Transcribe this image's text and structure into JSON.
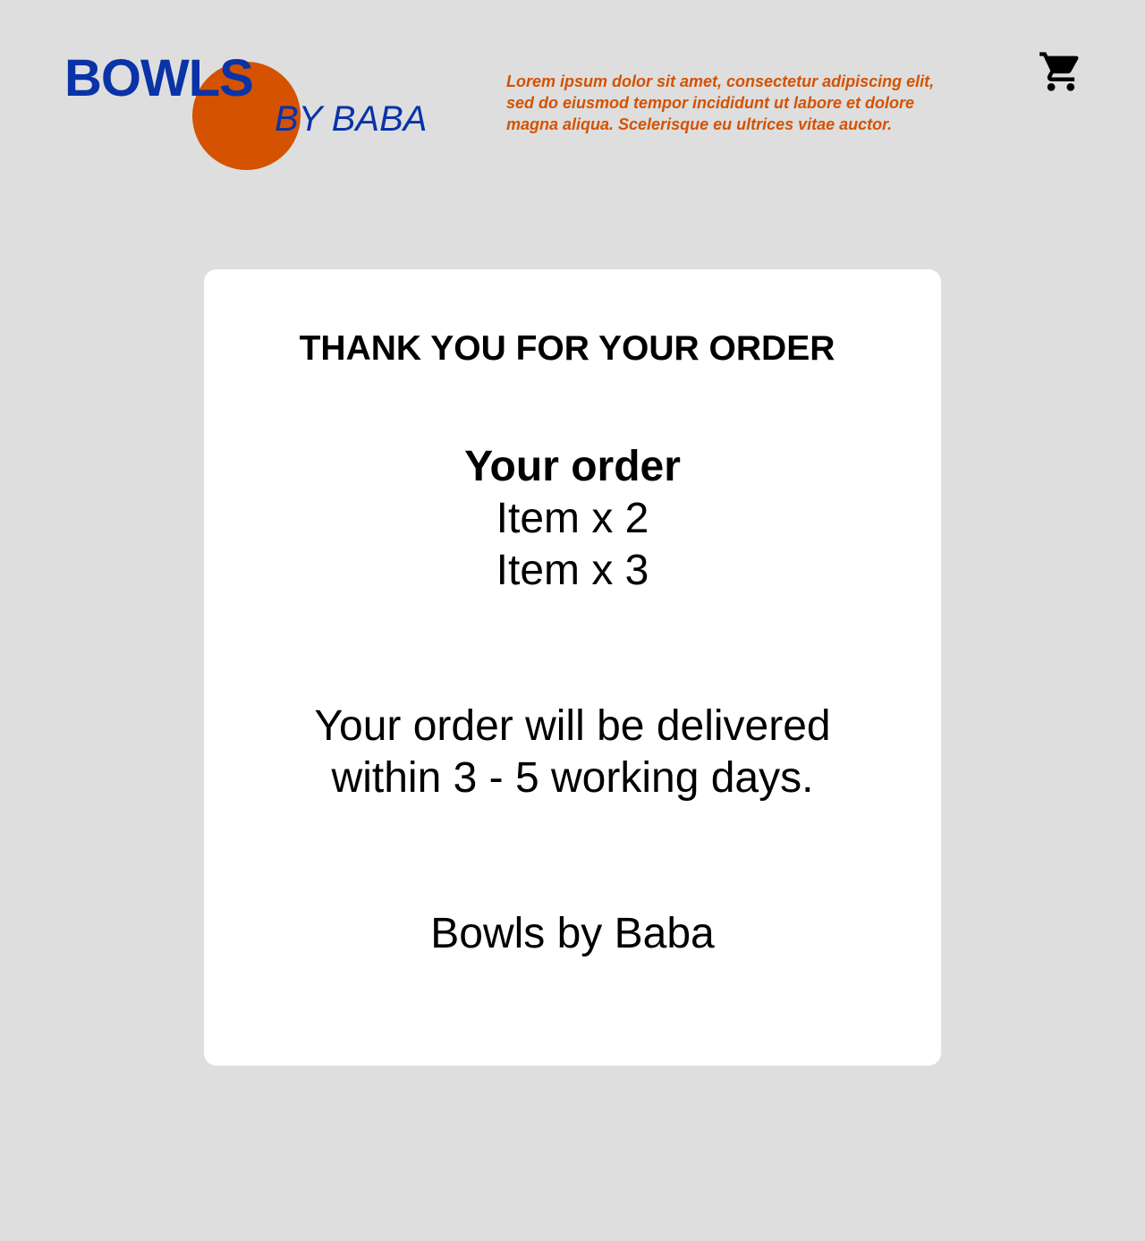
{
  "brand": {
    "name_primary": "BOWLS",
    "name_secondary": "BY BABA",
    "primary_color": "#0a33a8",
    "accent_color": "#d45200"
  },
  "header": {
    "tagline": "Lorem ipsum dolor sit amet, consectetur adipiscing elit, sed do eiusmod tempor incididunt ut labore et dolore magna aliqua. Scelerisque eu ultrices vitae auctor.",
    "cart_icon": "shopping-cart-icon"
  },
  "confirmation": {
    "heading": "THANK YOU FOR YOUR ORDER",
    "order_title": "Your order",
    "items": [
      {
        "text": "Item x 2"
      },
      {
        "text": "Item x 3"
      }
    ],
    "delivery_line1": "Your order will be delivered",
    "delivery_line2": "within 3 - 5 working days.",
    "signoff": "Bowls by Baba"
  }
}
